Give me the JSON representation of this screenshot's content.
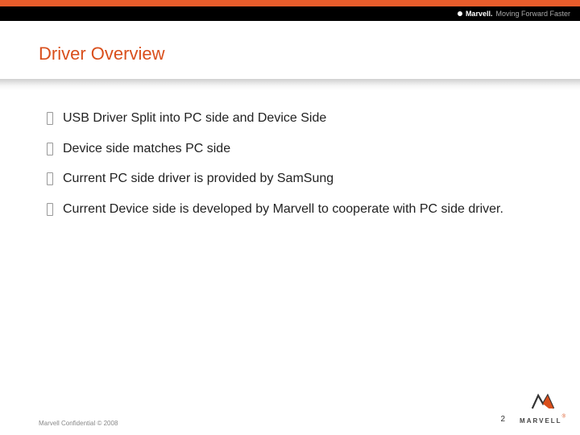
{
  "header": {
    "tagline_brand": "Marvell.",
    "tagline_rest": "Moving Forward Faster"
  },
  "title": "Driver Overview",
  "bullets": [
    "USB Driver Split into PC side and Device Side",
    "Device side matches PC side",
    "Current PC side driver is provided by SamSung",
    "Current Device side is developed by Marvell to cooperate with PC side driver."
  ],
  "footer": {
    "confidential": "Marvell Confidential © 2008",
    "page_number": "2",
    "logo_text": "MARVELL",
    "logo_reg": "®"
  }
}
